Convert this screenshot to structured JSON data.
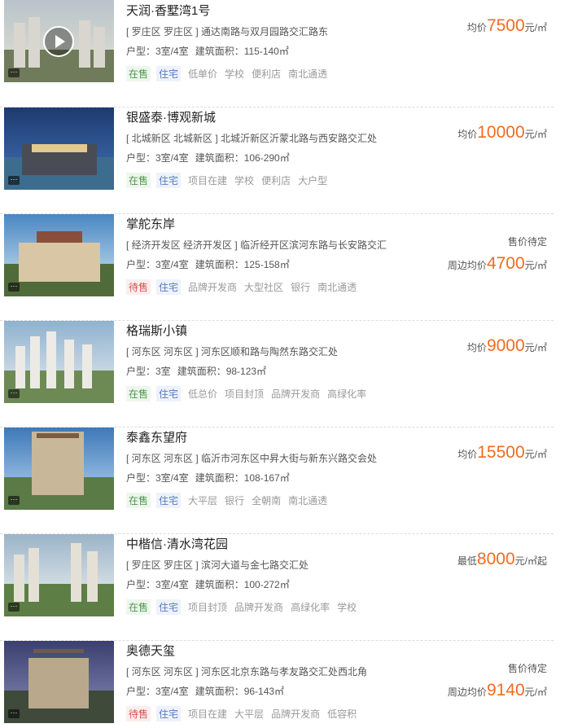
{
  "listings": [
    {
      "name": "天润·香墅湾1号",
      "address": "[ 罗庄区 罗庄区 ] 通达南路与双月园路交汇路东",
      "layout": "户型：3室/4室",
      "area": "建筑面积：115-140㎡",
      "status": "在售",
      "type": "住宅",
      "tags": [
        "低单价",
        "学校",
        "便利店",
        "南北通透"
      ],
      "price_prefix": "均价",
      "price": "7500",
      "price_unit": "元/㎡",
      "price_suffix": ""
    },
    {
      "name": "银盛泰·博观新城",
      "address": "[ 北城新区 北城新区 ] 北城沂新区沂蒙北路与西安路交汇处",
      "layout": "户型：3室/4室",
      "area": "建筑面积：106-290㎡",
      "status": "在售",
      "type": "住宅",
      "tags": [
        "项目在建",
        "学校",
        "便利店",
        "大户型"
      ],
      "price_prefix": "均价",
      "price": "10000",
      "price_unit": "元/㎡",
      "price_suffix": ""
    },
    {
      "name": "掌舵东岸",
      "address": "[ 经济开发区 经济开发区 ] 临沂经开区滨河东路与长安路交汇",
      "layout": "户型：3室/4室",
      "area": "建筑面积：125-158㎡",
      "status": "待售",
      "type": "住宅",
      "tags": [
        "品牌开发商",
        "大型社区",
        "银行",
        "南北通透"
      ],
      "pending_label": "售价待定",
      "price_prefix": "周边均价",
      "price": "4700",
      "price_unit": "元/㎡",
      "price_suffix": ""
    },
    {
      "name": "格瑞斯小镇",
      "address": "[ 河东区 河东区 ] 河东区顺和路与陶然东路交汇处",
      "layout": "户型：3室",
      "area": "建筑面积：98-123㎡",
      "status": "在售",
      "type": "住宅",
      "tags": [
        "低总价",
        "项目封顶",
        "品牌开发商",
        "高绿化率"
      ],
      "price_prefix": "均价",
      "price": "9000",
      "price_unit": "元/㎡",
      "price_suffix": ""
    },
    {
      "name": "泰鑫东望府",
      "address": "[ 河东区 河东区 ] 临沂市河东区中昇大街与新东兴路交会处",
      "layout": "户型：3室/4室",
      "area": "建筑面积：108-167㎡",
      "status": "在售",
      "type": "住宅",
      "tags": [
        "大平层",
        "银行",
        "全朝南",
        "南北通透"
      ],
      "price_prefix": "均价",
      "price": "15500",
      "price_unit": "元/㎡",
      "price_suffix": ""
    },
    {
      "name": "中楷信·清水湾花园",
      "address": "[ 罗庄区 罗庄区 ] 滨河大道与金七路交汇处",
      "layout": "户型：3室/4室",
      "area": "建筑面积：100-272㎡",
      "status": "在售",
      "type": "住宅",
      "tags": [
        "项目封顶",
        "品牌开发商",
        "高绿化率",
        "学校"
      ],
      "price_prefix": "最低",
      "price": "8000",
      "price_unit": "元/㎡",
      "price_suffix": "起"
    },
    {
      "name": "奥德天玺",
      "address": "[ 河东区 河东区 ] 河东区北京东路与孝友路交汇处西北角",
      "layout": "户型：3室/4室",
      "area": "建筑面积：96-143㎡",
      "status": "待售",
      "type": "住宅",
      "tags": [
        "项目在建",
        "大平层",
        "品牌开发商",
        "低容积"
      ],
      "pending_label": "售价待定",
      "price_prefix": "周边均价",
      "price": "9140",
      "price_unit": "元/㎡",
      "price_suffix": ""
    }
  ],
  "chat_icon_glyph": "···"
}
